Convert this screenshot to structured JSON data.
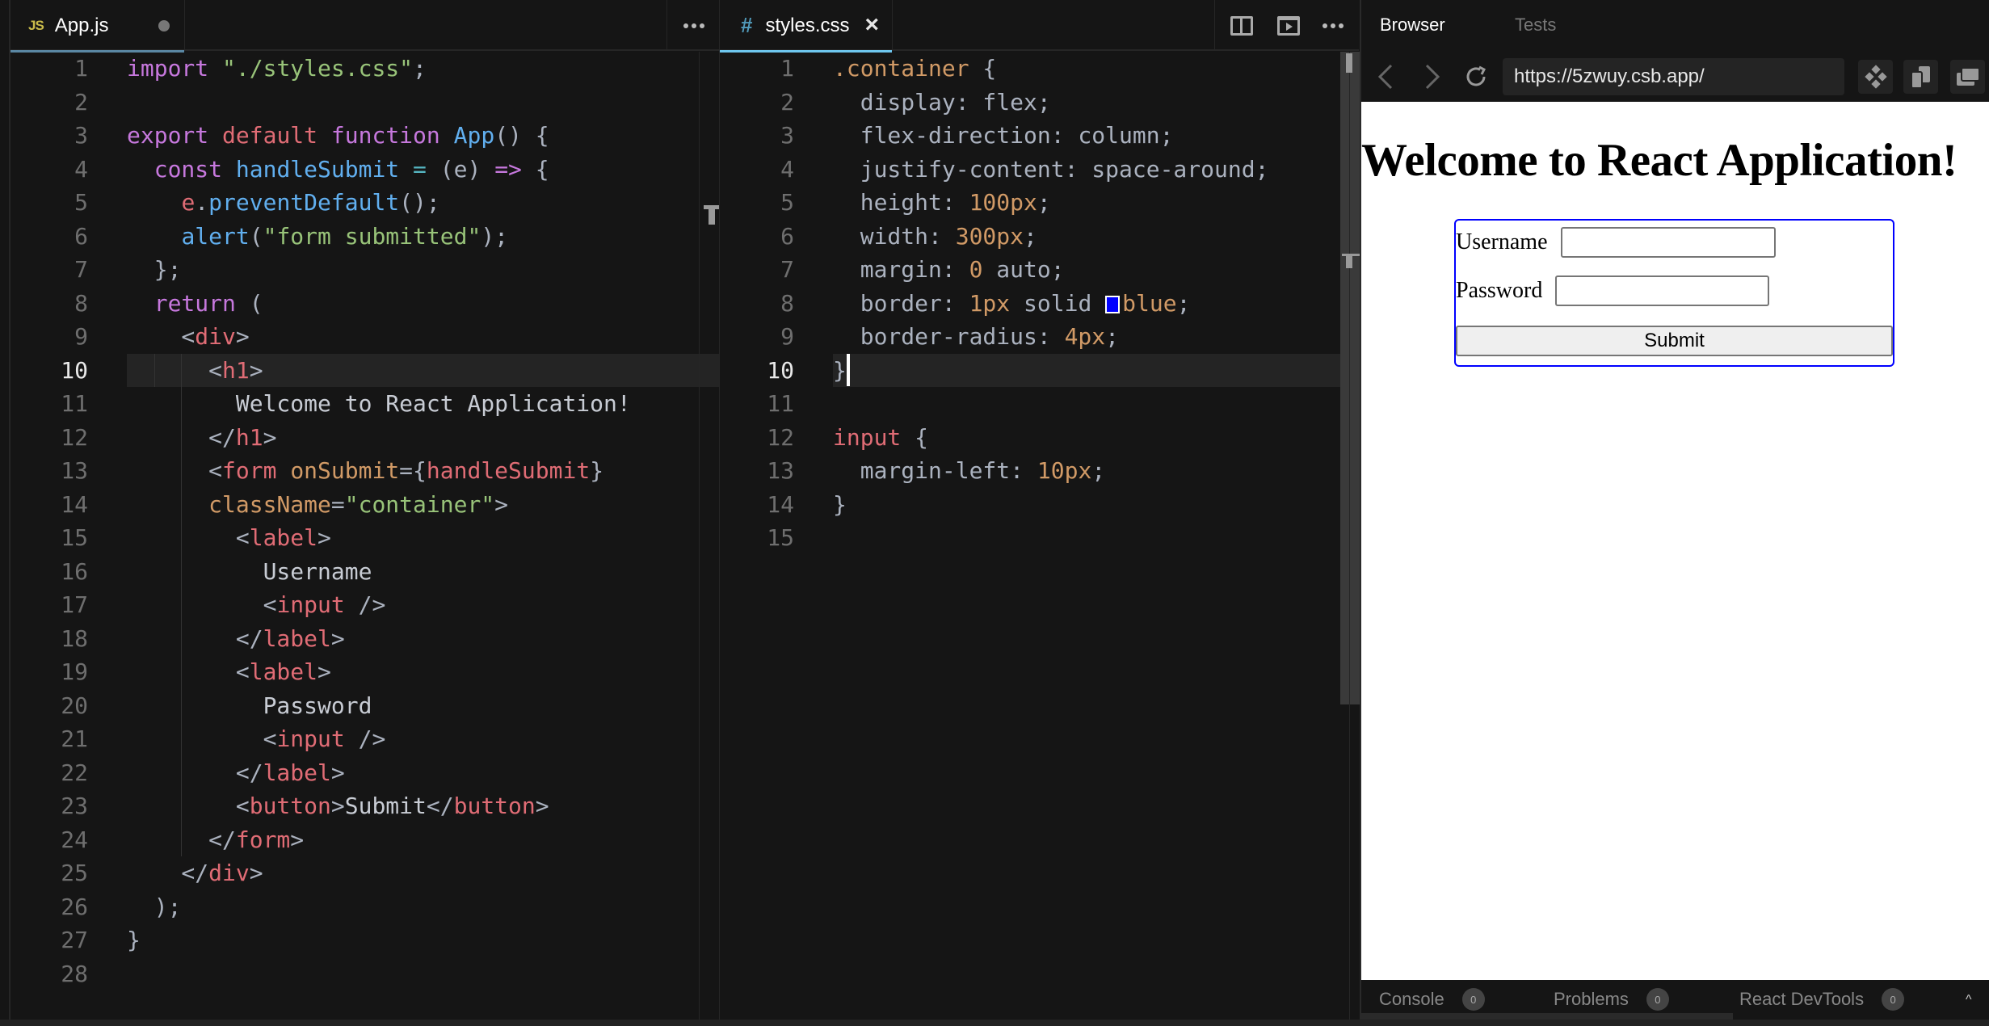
{
  "editor_left": {
    "tab": {
      "icon": "JS",
      "label": "App.js",
      "dirty": true
    },
    "more_label": "more-actions",
    "active_line": 10,
    "lines": [
      [
        [
          "kw",
          "import"
        ],
        [
          "pl",
          " "
        ],
        [
          "str",
          "\"./styles.css\""
        ],
        [
          "pl",
          ";"
        ]
      ],
      [],
      [
        [
          "kw",
          "export"
        ],
        [
          "pl",
          " "
        ],
        [
          "tag",
          "default"
        ],
        [
          "pl",
          " "
        ],
        [
          "kw",
          "function"
        ],
        [
          "pl",
          " "
        ],
        [
          "fn",
          "App"
        ],
        [
          "pl",
          "() {"
        ]
      ],
      [
        [
          "pl",
          "  "
        ],
        [
          "kw",
          "const"
        ],
        [
          "pl",
          " "
        ],
        [
          "fn",
          "handleSubmit"
        ],
        [
          "pl",
          " "
        ],
        [
          "op",
          "="
        ],
        [
          "pl",
          " (e) "
        ],
        [
          "kw",
          "=>"
        ],
        [
          "pl",
          " {"
        ]
      ],
      [
        [
          "pl",
          "    "
        ],
        [
          "tag",
          "e"
        ],
        [
          "pl",
          "."
        ],
        [
          "fn",
          "preventDefault"
        ],
        [
          "pl",
          "();"
        ]
      ],
      [
        [
          "pl",
          "    "
        ],
        [
          "fn",
          "alert"
        ],
        [
          "pl",
          "("
        ],
        [
          "str",
          "\"form submitted\""
        ],
        [
          "pl",
          ");"
        ]
      ],
      [
        [
          "pl",
          "  };"
        ]
      ],
      [
        [
          "pl",
          "  "
        ],
        [
          "kw",
          "return"
        ],
        [
          "pl",
          " ("
        ]
      ],
      [
        [
          "pl",
          "    <"
        ],
        [
          "tag",
          "div"
        ],
        [
          "pl",
          ">"
        ]
      ],
      [
        [
          "pl",
          "      <"
        ],
        [
          "tag",
          "h1"
        ],
        [
          "pl",
          ">"
        ]
      ],
      [
        [
          "txt",
          "        Welcome to React Application!"
        ]
      ],
      [
        [
          "pl",
          "      </"
        ],
        [
          "tag",
          "h1"
        ],
        [
          "pl",
          ">"
        ]
      ],
      [
        [
          "pl",
          "      <"
        ],
        [
          "tag",
          "form"
        ],
        [
          "pl",
          " "
        ],
        [
          "attr",
          "onSubmit"
        ],
        [
          "pl",
          "={"
        ],
        [
          "tag",
          "handleSubmit"
        ],
        [
          "pl",
          "}"
        ]
      ],
      [
        [
          "pl",
          "      "
        ],
        [
          "attr",
          "className"
        ],
        [
          "pl",
          "="
        ],
        [
          "str",
          "\"container\""
        ],
        [
          "pl",
          ">"
        ]
      ],
      [
        [
          "pl",
          "        <"
        ],
        [
          "tag",
          "label"
        ],
        [
          "pl",
          ">"
        ]
      ],
      [
        [
          "txt",
          "          Username"
        ]
      ],
      [
        [
          "pl",
          "          <"
        ],
        [
          "tag",
          "input"
        ],
        [
          "pl",
          " />"
        ]
      ],
      [
        [
          "pl",
          "        </"
        ],
        [
          "tag",
          "label"
        ],
        [
          "pl",
          ">"
        ]
      ],
      [
        [
          "pl",
          "        <"
        ],
        [
          "tag",
          "label"
        ],
        [
          "pl",
          ">"
        ]
      ],
      [
        [
          "txt",
          "          Password"
        ]
      ],
      [
        [
          "pl",
          "          <"
        ],
        [
          "tag",
          "input"
        ],
        [
          "pl",
          " />"
        ]
      ],
      [
        [
          "pl",
          "        </"
        ],
        [
          "tag",
          "label"
        ],
        [
          "pl",
          ">"
        ]
      ],
      [
        [
          "pl",
          "        <"
        ],
        [
          "tag",
          "button"
        ],
        [
          "pl",
          ">"
        ],
        [
          "txt",
          "Submit"
        ],
        [
          "pl",
          "</"
        ],
        [
          "tag",
          "button"
        ],
        [
          "pl",
          ">"
        ]
      ],
      [
        [
          "pl",
          "      </"
        ],
        [
          "tag",
          "form"
        ],
        [
          "pl",
          ">"
        ]
      ],
      [
        [
          "pl",
          "    </"
        ],
        [
          "tag",
          "div"
        ],
        [
          "pl",
          ">"
        ]
      ],
      [
        [
          "pl",
          "  );"
        ]
      ],
      [
        [
          "pl",
          "}"
        ]
      ],
      []
    ]
  },
  "editor_right": {
    "tab": {
      "icon": "#",
      "label": "styles.css",
      "close": "×"
    },
    "active_line": 10,
    "lines": [
      [
        [
          "sel",
          ".container"
        ],
        [
          "pl",
          " {"
        ]
      ],
      [
        [
          "prop",
          "  display: flex;"
        ]
      ],
      [
        [
          "prop",
          "  flex-direction: column;"
        ]
      ],
      [
        [
          "prop",
          "  justify-content: space-around;"
        ]
      ],
      [
        [
          "prop",
          "  height: "
        ],
        [
          "num",
          "100px"
        ],
        [
          "pl",
          ";"
        ]
      ],
      [
        [
          "prop",
          "  width: "
        ],
        [
          "num",
          "300px"
        ],
        [
          "pl",
          ";"
        ]
      ],
      [
        [
          "prop",
          "  margin: "
        ],
        [
          "num",
          "0"
        ],
        [
          "pl",
          " auto;"
        ]
      ],
      [
        [
          "prop",
          "  border: "
        ],
        [
          "num",
          "1px"
        ],
        [
          "pl",
          " solid "
        ],
        [
          "swatch",
          "#0000ff"
        ],
        [
          "num",
          "blue"
        ],
        [
          "pl",
          ";"
        ]
      ],
      [
        [
          "prop",
          "  border-radius: "
        ],
        [
          "num",
          "4px"
        ],
        [
          "pl",
          ";"
        ]
      ],
      [
        [
          "pl",
          "}"
        ],
        [
          "cursor",
          ""
        ]
      ],
      [],
      [
        [
          "tag",
          "input"
        ],
        [
          "pl",
          " {"
        ]
      ],
      [
        [
          "prop",
          "  margin-left: "
        ],
        [
          "num",
          "10px"
        ],
        [
          "pl",
          ";"
        ]
      ],
      [
        [
          "pl",
          "}"
        ]
      ],
      []
    ]
  },
  "browser": {
    "tabs": [
      {
        "label": "Browser",
        "active": true
      },
      {
        "label": "Tests",
        "active": false
      }
    ],
    "url": "https://5zwuy.csb.app/",
    "preview": {
      "heading": "Welcome to React Application!",
      "username_label": "Username",
      "password_label": "Password",
      "username_value": "",
      "password_value": "",
      "submit_label": "Submit",
      "form_border_color": "#0000ff"
    },
    "bottom_tabs": [
      {
        "label": "Console",
        "count": "0"
      },
      {
        "label": "Problems",
        "count": "0"
      },
      {
        "label": "React DevTools",
        "count": "0"
      }
    ],
    "expand_glyph": "^"
  }
}
